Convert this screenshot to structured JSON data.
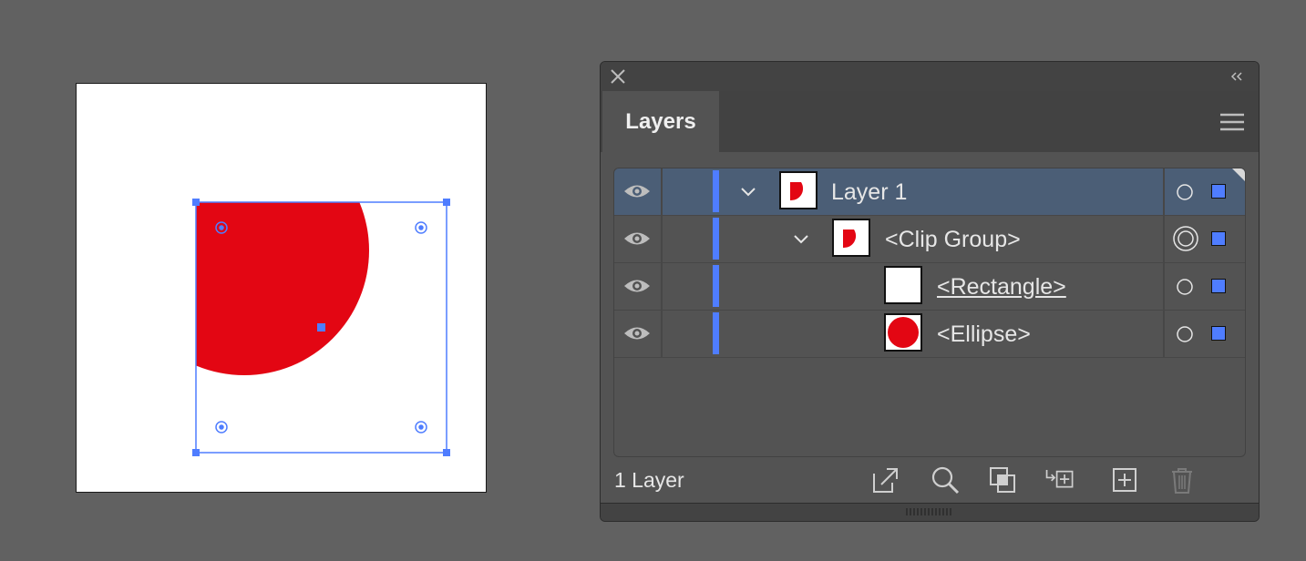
{
  "panel": {
    "tab_label": "Layers",
    "footer_label": "1 Layer"
  },
  "layers": [
    {
      "label": "Layer 1",
      "selected": true,
      "expanded": true,
      "indent": 0,
      "thumb": "clip-shape",
      "target": "ring"
    },
    {
      "label": "<Clip Group>",
      "selected": false,
      "expanded": true,
      "indent": 1,
      "thumb": "clip-shape",
      "target": "double-ring"
    },
    {
      "label": "<Rectangle>",
      "selected": false,
      "expanded": false,
      "indent": 2,
      "thumb": "blank",
      "target": "ring",
      "underlined": true
    },
    {
      "label": "<Ellipse>",
      "selected": false,
      "expanded": false,
      "indent": 2,
      "thumb": "red-circle",
      "target": "ring"
    }
  ],
  "footer_icons": [
    "export-icon",
    "locate-object-icon",
    "make-clipping-mask-icon",
    "create-sublayer-icon",
    "new-layer-icon",
    "trash-icon"
  ],
  "colors": {
    "layer_color": "#4f7dff",
    "shape_fill": "#e30613",
    "selection": "#4f7dff",
    "selected_row": "#4b5e76"
  }
}
